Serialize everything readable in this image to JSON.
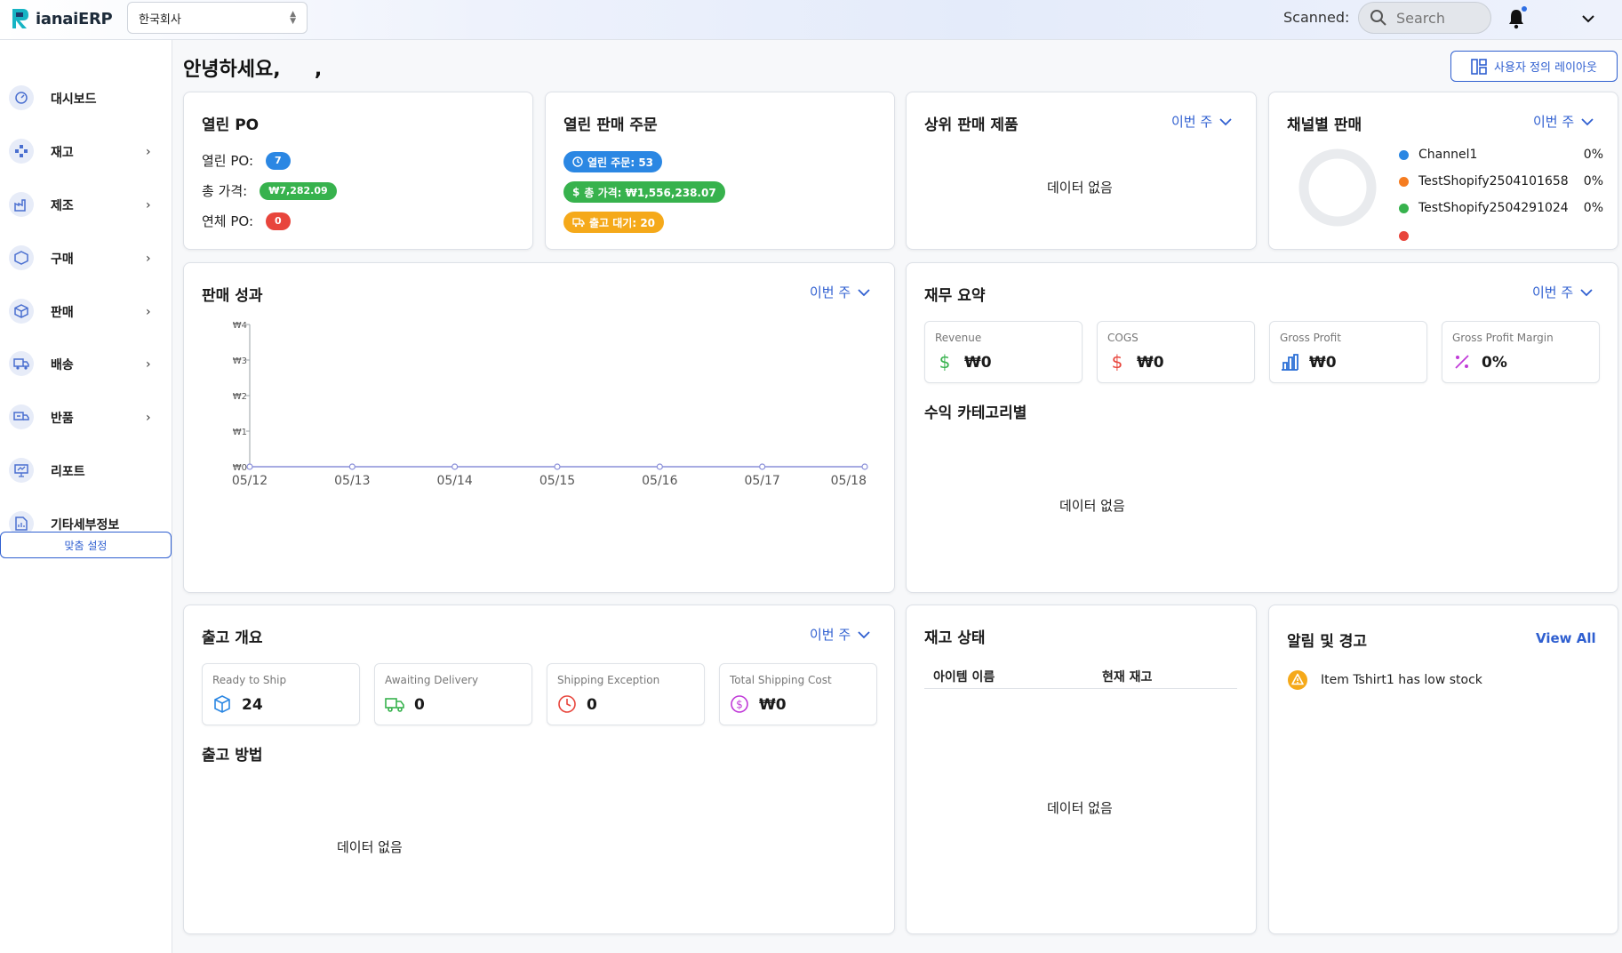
{
  "app": {
    "name": "ianaiERP",
    "company": "한국회사",
    "scanned_label": "Scanned:",
    "search_placeholder": "Search"
  },
  "sidebar": {
    "items": [
      {
        "label": "대시보드",
        "icon": "dashboard-icon"
      },
      {
        "label": "재고",
        "icon": "inventory-icon"
      },
      {
        "label": "제조",
        "icon": "factory-icon"
      },
      {
        "label": "구매",
        "icon": "purchase-icon"
      },
      {
        "label": "판매",
        "icon": "sales-icon"
      },
      {
        "label": "배송",
        "icon": "truck-icon"
      },
      {
        "label": "반품",
        "icon": "return-icon"
      },
      {
        "label": "리포트",
        "icon": "report-icon"
      },
      {
        "label": "기타세부정보",
        "icon": "document-icon"
      }
    ],
    "custom_settings": "맞춤 설정"
  },
  "header": {
    "greeting": "안녕하세요,     ,",
    "custom_layout": "사용자 정의 레이아웃"
  },
  "open_po": {
    "title": "열린 PO",
    "open_label": "열린 PO:",
    "open_value": "7",
    "total_label": "총 가격:",
    "total_value": "₩7,282.09",
    "overdue_label": "연체 PO:",
    "overdue_value": "0"
  },
  "open_sales": {
    "title": "열린 판매 주문",
    "open_orders": "열린 주문: 53",
    "total_price": "총 가격: ₩1,556,238.07",
    "pending_shipping": "출고 대기: 20"
  },
  "top_products": {
    "title": "상위 판매 제품",
    "period": "이번 주",
    "empty": "데이터 없음"
  },
  "channel_sales": {
    "title": "채널별 판매",
    "period": "이번 주",
    "channels": [
      {
        "name": "Channel1",
        "pct": "0%",
        "color": "#2b87e3"
      },
      {
        "name": "TestShopify2504101658",
        "pct": "0%",
        "color": "#f57c20"
      },
      {
        "name": "TestShopify2504291024",
        "pct": "0%",
        "color": "#37b24d"
      }
    ]
  },
  "sales_performance": {
    "title": "판매 성과",
    "period": "이번 주"
  },
  "chart_data": {
    "type": "line",
    "categories": [
      "05/12",
      "05/13",
      "05/14",
      "05/15",
      "05/16",
      "05/17",
      "05/18"
    ],
    "series": [
      {
        "values": [
          0,
          0,
          0,
          0,
          0,
          0,
          0
        ]
      }
    ],
    "y_ticks": [
      "₩0",
      "₩1",
      "₩2",
      "₩3",
      "₩4"
    ],
    "ylim": [
      0,
      4
    ],
    "title": "판매 성과",
    "xlabel": "",
    "ylabel": "",
    "grid": false,
    "line_color": "#8a8fd9"
  },
  "finance": {
    "title": "재무 요약",
    "period": "이번 주",
    "stats": [
      {
        "label": "Revenue",
        "value": "₩0",
        "icon": "dollar-icon",
        "color": "#37b24d"
      },
      {
        "label": "COGS",
        "value": "₩0",
        "icon": "dollar-icon",
        "color": "#e8453c"
      },
      {
        "label": "Gross Profit",
        "value": "₩0",
        "icon": "bar-chart-icon",
        "color": "#2b6fd6"
      },
      {
        "label": "Gross Profit Margin",
        "value": "0%",
        "icon": "percent-icon",
        "color": "#c03ad8"
      }
    ],
    "by_category_title": "수익 카테고리별",
    "empty": "데이터 없음"
  },
  "shipping": {
    "title": "출고 개요",
    "period": "이번 주",
    "stats": [
      {
        "label": "Ready to Ship",
        "value": "24",
        "icon": "box-icon",
        "color": "#2b87e3"
      },
      {
        "label": "Awaiting Delivery",
        "value": "0",
        "icon": "truck-icon",
        "color": "#37b24d"
      },
      {
        "label": "Shipping Exception",
        "value": "0",
        "icon": "clock-icon",
        "color": "#e8453c"
      },
      {
        "label": "Total Shipping Cost",
        "value": "₩0",
        "icon": "dollar-circle-icon",
        "color": "#c03ad8"
      }
    ],
    "methods_title": "출고 방법",
    "empty": "데이터 없음"
  },
  "inventory_status": {
    "title": "재고 상태",
    "col_item": "아이템 이름",
    "col_stock": "현재 재고",
    "empty": "데이터 없음"
  },
  "alerts": {
    "title": "알림 및 경고",
    "view_all": "View All",
    "items": [
      {
        "text": "Item Tshirt1 has low stock",
        "color": "#f5a91a"
      }
    ]
  }
}
